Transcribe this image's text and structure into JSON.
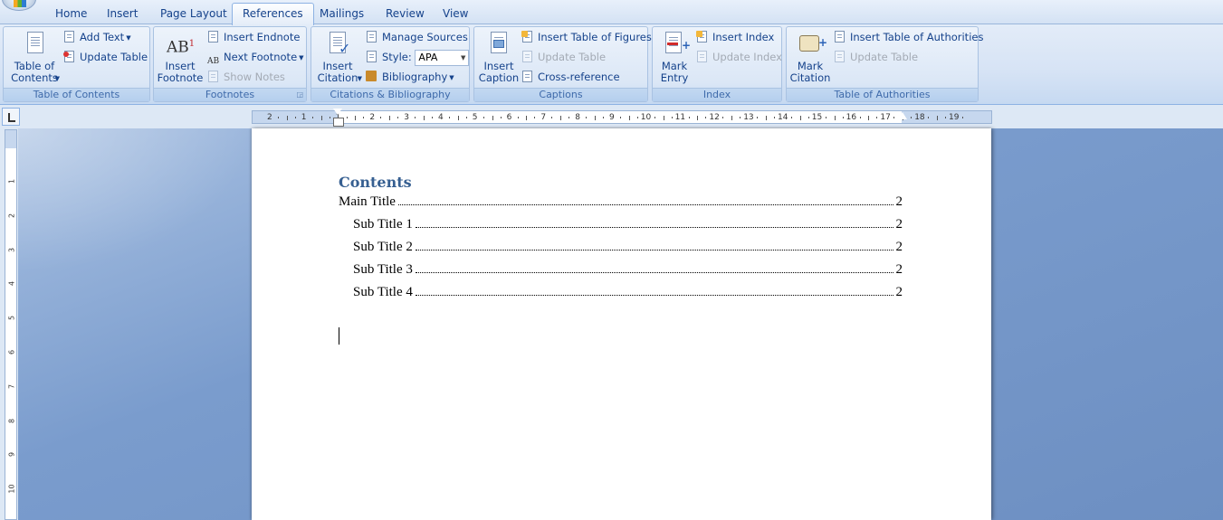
{
  "tabs": [
    {
      "label": "Home"
    },
    {
      "label": "Insert"
    },
    {
      "label": "Page Layout"
    },
    {
      "label": "References",
      "active": true
    },
    {
      "label": "Mailings"
    },
    {
      "label": "Review"
    },
    {
      "label": "View"
    }
  ],
  "ribbon": {
    "toc": {
      "label": "Table of Contents",
      "big_button": "Table of Contents",
      "add_text": "Add Text",
      "update_table": "Update Table"
    },
    "footnotes": {
      "label": "Footnotes",
      "big_icon_text": "AB",
      "big_icon_sup": "1",
      "big_button": "Insert Footnote",
      "insert_endnote": "Insert Endnote",
      "next_footnote": "Next Footnote",
      "next_icon_text": "AB",
      "show_notes": "Show Notes"
    },
    "citations": {
      "label": "Citations & Bibliography",
      "big_button": "Insert Citation",
      "manage_sources": "Manage Sources",
      "style_label": "Style:",
      "style_value": "APA",
      "bibliography": "Bibliography"
    },
    "captions": {
      "label": "Captions",
      "big_button": "Insert Caption",
      "insert_tof": "Insert Table of Figures",
      "update_table": "Update Table",
      "cross_reference": "Cross-reference"
    },
    "index": {
      "label": "Index",
      "big_button": "Mark Entry",
      "insert_index": "Insert Index",
      "update_index": "Update Index"
    },
    "authorities": {
      "label": "Table of Authorities",
      "big_button": "Mark Citation",
      "insert_toa": "Insert Table of Authorities",
      "update_table": "Update Table"
    }
  },
  "ruler": {
    "h_ticks": [
      "2",
      "1",
      "1",
      "2",
      "3",
      "4",
      "5",
      "6",
      "7",
      "8",
      "9",
      "10",
      "11",
      "12",
      "13",
      "14",
      "15",
      "16",
      "17",
      "18",
      "19"
    ],
    "v_ticks": [
      "1",
      "2",
      "3",
      "4",
      "5",
      "6",
      "7",
      "8",
      "9",
      "10"
    ]
  },
  "document": {
    "toc_heading": "Contents",
    "entries": [
      {
        "text": "Main Title",
        "page": "2",
        "level": 1
      },
      {
        "text": "Sub Title 1",
        "page": "2",
        "level": 2
      },
      {
        "text": "Sub Title 2",
        "page": "2",
        "level": 2
      },
      {
        "text": "Sub Title 3",
        "page": "2",
        "level": 2
      },
      {
        "text": "Sub Title 4",
        "page": "2",
        "level": 2
      }
    ]
  }
}
